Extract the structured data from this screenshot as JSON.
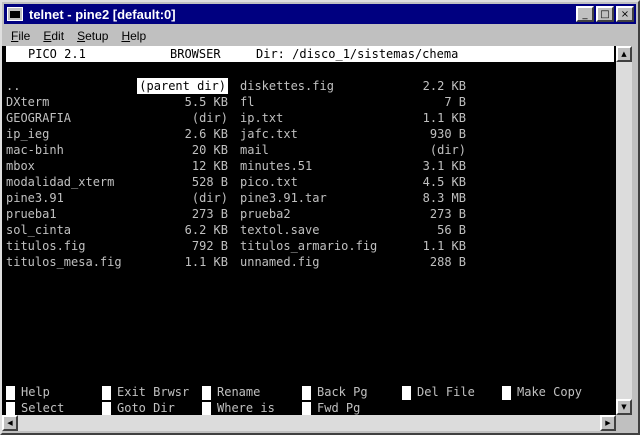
{
  "window": {
    "title": "telnet - pine2 [default:0]"
  },
  "window_buttons": {
    "minimize": "_",
    "maximize": "□",
    "close": "×"
  },
  "menu": [
    {
      "label": "File",
      "underline": "F",
      "rest": "ile"
    },
    {
      "label": "Edit",
      "underline": "E",
      "rest": "dit"
    },
    {
      "label": "Setup",
      "underline": "S",
      "rest": "etup"
    },
    {
      "label": "Help",
      "underline": "H",
      "rest": "elp"
    }
  ],
  "header": {
    "app": "PICO 2.1",
    "mode": "BROWSER",
    "dir": "Dir: /disco_1/sistemas/chema"
  },
  "left_files": [
    {
      "name": "..",
      "size": "(parent dir)"
    },
    {
      "name": "DXterm",
      "size": "5.5 KB"
    },
    {
      "name": "GEOGRAFIA",
      "size": "(dir)"
    },
    {
      "name": "ip_ieg",
      "size": "2.6 KB"
    },
    {
      "name": "mac-binh",
      "size": "20 KB"
    },
    {
      "name": "mbox",
      "size": "12 KB"
    },
    {
      "name": "modalidad_xterm",
      "size": "528 B"
    },
    {
      "name": "pine3.91",
      "size": "(dir)"
    },
    {
      "name": "prueba1",
      "size": "273 B"
    },
    {
      "name": "sol_cinta",
      "size": "6.2 KB"
    },
    {
      "name": "titulos.fig",
      "size": "792 B"
    },
    {
      "name": "titulos_mesa.fig",
      "size": "1.1 KB"
    }
  ],
  "right_files": [
    {
      "name": "diskettes.fig",
      "size": "2.2 KB"
    },
    {
      "name": "fl",
      "size": "7 B"
    },
    {
      "name": "ip.txt",
      "size": "1.1 KB"
    },
    {
      "name": "jafc.txt",
      "size": "930 B"
    },
    {
      "name": "mail",
      "size": "(dir)"
    },
    {
      "name": "minutes.51",
      "size": "3.1 KB"
    },
    {
      "name": "pico.txt",
      "size": "4.5 KB"
    },
    {
      "name": "pine3.91.tar",
      "size": "8.3 MB"
    },
    {
      "name": "prueba2",
      "size": "273 B"
    },
    {
      "name": "textol.save",
      "size": "56 B"
    },
    {
      "name": "titulos_armario.fig",
      "size": "1.1 KB"
    },
    {
      "name": "unnamed.fig",
      "size": "288 B"
    }
  ],
  "help": {
    "row1": [
      "Help",
      "Exit Brwsr",
      "Rename",
      "Back Pg",
      "Del File",
      "Make Copy"
    ],
    "row2": [
      "Select",
      "Goto Dir",
      "Where is",
      "Fwd Pg",
      "",
      ""
    ]
  },
  "scroll_glyphs": {
    "up": "▲",
    "down": "▼",
    "left": "◀",
    "right": "▶"
  }
}
